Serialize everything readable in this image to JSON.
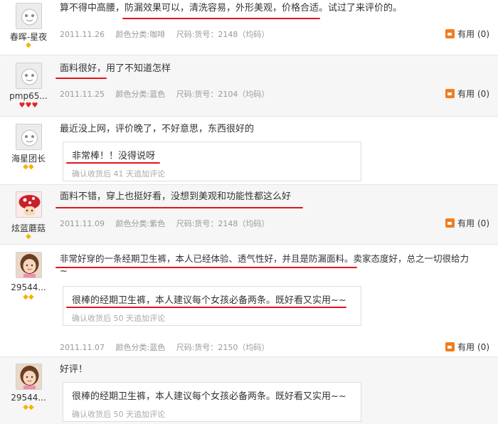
{
  "reviews": [
    {
      "user": "春晖-星夜",
      "avatar": "default-face",
      "content": "算不得中高腰，防漏效果可以，清洗容易，外形美观，价格合适。试过了来评价的。",
      "date": "2011.11.26",
      "color": "颜色分类:咖啡",
      "size": "尺码:货号：2148（均码）",
      "useful_label": "有用",
      "useful_count": "(0)"
    },
    {
      "user": "pmp65...",
      "avatar": "default-face",
      "content": "面料很好，用了不知道怎样",
      "date": "2011.11.25",
      "color": "颜色分类:蓝色",
      "size": "尺码:货号：2104（均码）",
      "useful_label": "有用",
      "useful_count": "(0)"
    },
    {
      "user": "海星团长",
      "avatar": "default-face",
      "content": "最近没上网，评价晚了，不好意思，东西很好的",
      "append": "非常棒！！没得说呀",
      "append_note": "确认收货后 41 天追加评论"
    },
    {
      "user": "炫蓝蘑菇",
      "avatar": "mushroom",
      "content": "面料不错，穿上也挺好看，没想到美观和功能性都这么好",
      "date": "2011.11.09",
      "color": "颜色分类:紫色",
      "size": "尺码:货号：2148（均码）",
      "useful_label": "有用",
      "useful_count": "(0)"
    },
    {
      "user": "29544...",
      "avatar": "girl",
      "content": "非常好穿的一条经期卫生裤，本人已经体验、透气性好，并且是防漏面料。卖家态度好，总之一切很给力",
      "content_cont": "~",
      "append": "很棒的经期卫生裤，本人建议每个女孩必备两条。既好看又实用~~",
      "append_note": "确认收货后 50 天追加评论",
      "date": "2011.11.07",
      "color": "颜色分类:蓝色",
      "size": "尺码:货号：2150（均码）",
      "useful_label": "有用",
      "useful_count": "(0)"
    },
    {
      "user": "29544...",
      "avatar": "girl",
      "content": "好评！",
      "append": "很棒的经期卫生裤，本人建议每个女孩必备两条。既好看又实用~~",
      "append_note": "确认收货后 50 天追加评论"
    }
  ],
  "colors": {
    "underline": "#e2141c",
    "useful_icon": "#f07d1e",
    "meta_text": "#999999"
  }
}
